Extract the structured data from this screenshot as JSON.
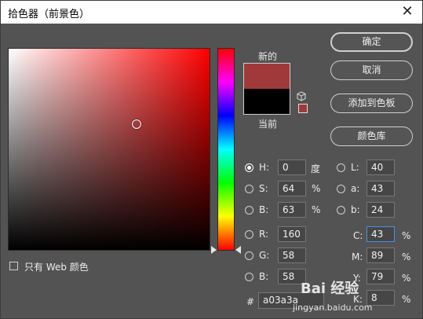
{
  "window": {
    "title": "拾色器（前景色）",
    "close_glyph": "✕"
  },
  "colors": {
    "new": "#a03a3a",
    "current": "#000000",
    "hue_base": "#ff0000"
  },
  "swatches": {
    "new_label": "新的",
    "current_label": "当前",
    "gamut_icon": "cube-icon"
  },
  "buttons": {
    "ok": "确定",
    "cancel": "取消",
    "add_swatch": "添加到色板",
    "library": "颜色库"
  },
  "fields": {
    "H": {
      "label": "H:",
      "value": "0",
      "unit": "度",
      "selected": true
    },
    "S": {
      "label": "S:",
      "value": "64",
      "unit": "%"
    },
    "Bv": {
      "label": "B:",
      "value": "63",
      "unit": "%"
    },
    "R": {
      "label": "R:",
      "value": "160"
    },
    "G": {
      "label": "G:",
      "value": "58"
    },
    "B": {
      "label": "B:",
      "value": "58"
    },
    "L": {
      "label": "L:",
      "value": "40"
    },
    "a": {
      "label": "a:",
      "value": "43"
    },
    "b": {
      "label": "b:",
      "value": "24"
    },
    "C": {
      "label": "C:",
      "value": "43",
      "unit": "%"
    },
    "M": {
      "label": "M:",
      "value": "89",
      "unit": "%"
    },
    "Y": {
      "label": "Y:",
      "value": "79",
      "unit": "%"
    },
    "K": {
      "label": "K:",
      "value": "8",
      "unit": "%"
    }
  },
  "hex": {
    "hash": "#",
    "value": "a03a3a"
  },
  "web_only": {
    "label": "只有 Web 颜色",
    "checked": false
  },
  "watermark": {
    "text": "Bai 经验",
    "sub": "jingyan.baidu.com"
  }
}
